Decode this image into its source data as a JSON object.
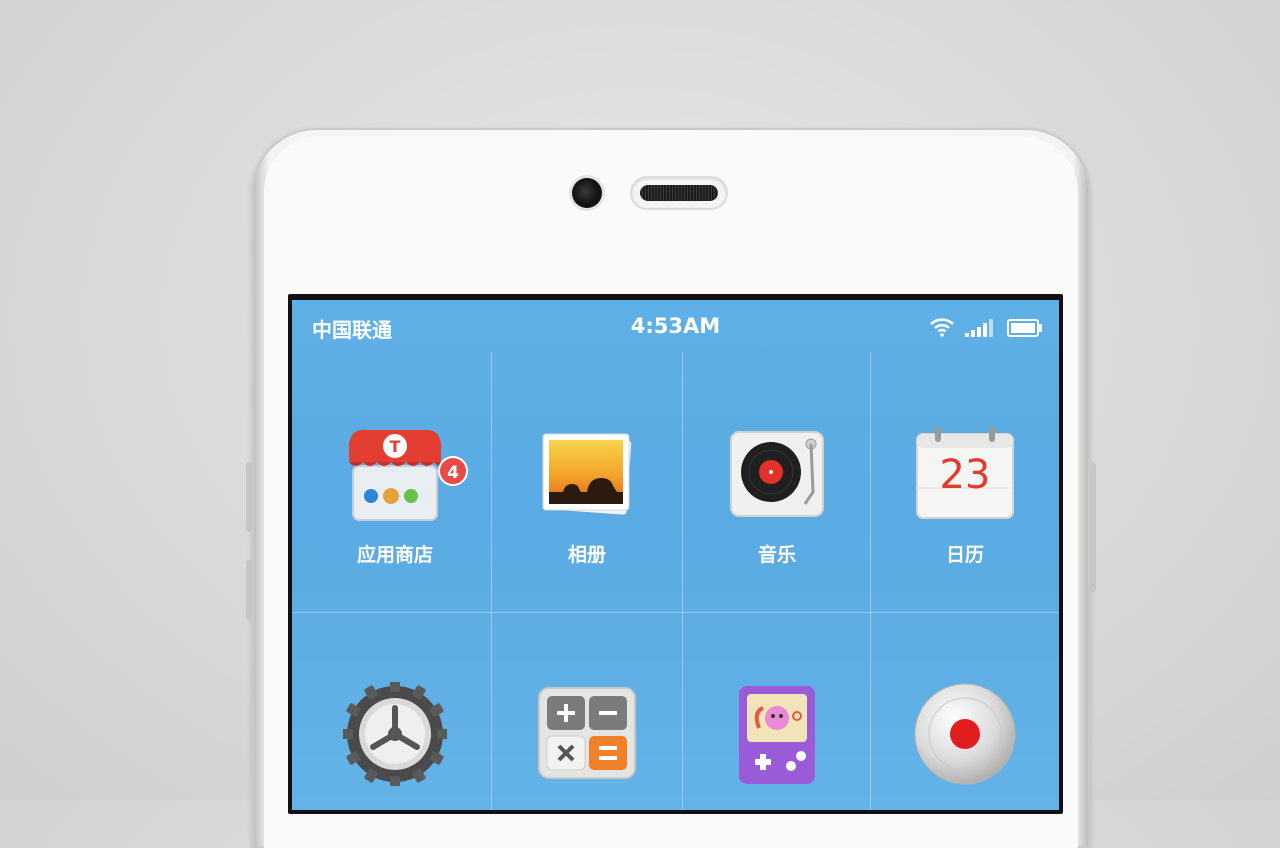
{
  "statusbar": {
    "carrier": "中国联通",
    "time": "4:53AM"
  },
  "apps": [
    {
      "label": "应用商店",
      "icon": "app-store-icon",
      "badge": "4"
    },
    {
      "label": "相册",
      "icon": "photo-album-icon"
    },
    {
      "label": "音乐",
      "icon": "music-icon"
    },
    {
      "label": "日历",
      "icon": "calendar-icon",
      "icon_text": "23"
    },
    {
      "label": "",
      "icon": "settings-icon"
    },
    {
      "label": "",
      "icon": "calculator-icon"
    },
    {
      "label": "",
      "icon": "game-center-icon"
    },
    {
      "label": "",
      "icon": "recorder-icon"
    }
  ],
  "colors": {
    "wallpaper": "#5fb0e6",
    "badge": "#e84a45",
    "calendar_digits": "#e23b2d"
  }
}
